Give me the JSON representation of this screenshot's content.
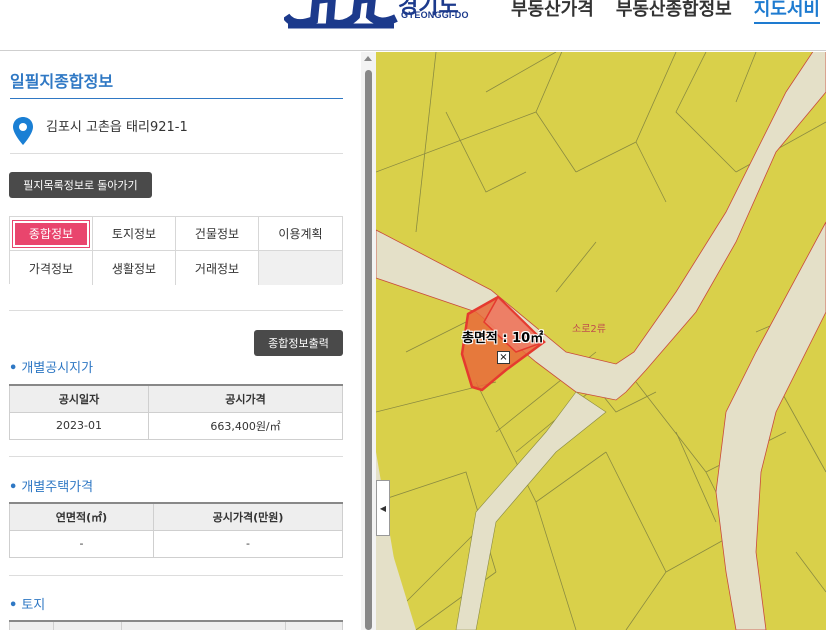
{
  "header": {
    "logo_text": "GYEONGGI-DO",
    "logo_kr": "경기도",
    "nav": [
      {
        "label": "부동산가격",
        "active": false
      },
      {
        "label": "부동산종합정보",
        "active": false
      },
      {
        "label": "지도서비",
        "active": true
      }
    ]
  },
  "panel": {
    "title": "일필지종합정보",
    "address": "김포시 고촌읍 태리921-1",
    "back_button": "필지목록정보로 돌아가기",
    "tabs": [
      "종합정보",
      "토지정보",
      "건물정보",
      "이용계획",
      "가격정보",
      "생활정보",
      "거래정보",
      ""
    ],
    "active_tab": "종합정보",
    "print_button": "종합정보출력",
    "section1": {
      "title": "개별공시지가",
      "headers": [
        "공시일자",
        "공시가격"
      ],
      "rows": [
        [
          "2023-01",
          "663,400원/㎡"
        ]
      ]
    },
    "section2": {
      "title": "개별주택가격",
      "headers": [
        "연면적(㎡)",
        "공시가격(만원)"
      ],
      "rows": [
        [
          "-",
          "-"
        ]
      ]
    },
    "section3": {
      "title": "토지"
    }
  },
  "map": {
    "road_label": "소로2류",
    "area_label": "총면적 : 10",
    "area_unit": "㎡",
    "colors": {
      "parcel": "#d9d04a",
      "road": "#e4e0c8",
      "selected": "#e53a2f"
    }
  }
}
